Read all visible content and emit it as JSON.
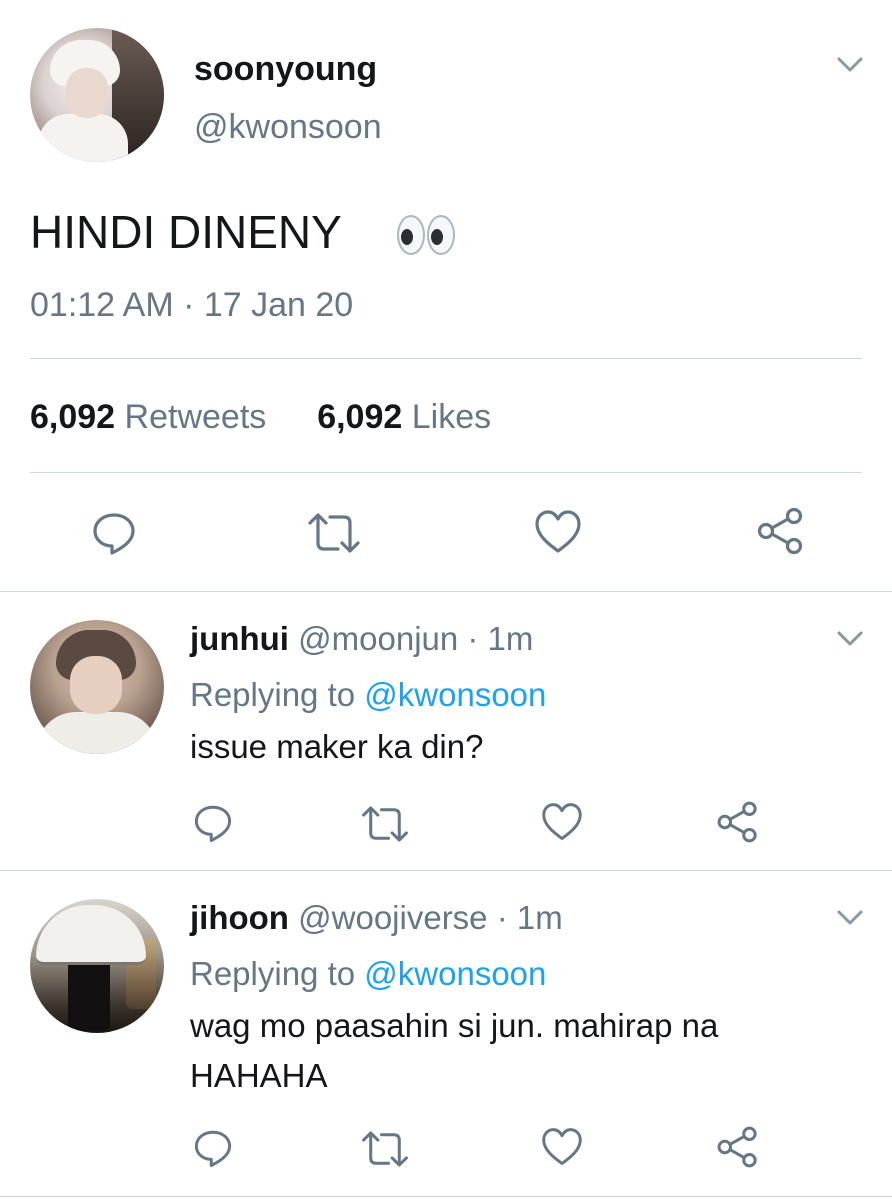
{
  "main_tweet": {
    "display_name": "soonyoung",
    "handle": "@kwonsoon",
    "text": "HINDI DINENY",
    "emoji": "eyes",
    "timestamp": "01:12 AM · 17 Jan 20",
    "retweets_count": "6,092",
    "retweets_label": "Retweets",
    "likes_count": "6,092",
    "likes_label": "Likes",
    "icons": [
      "chevron-down-icon",
      "reply-icon",
      "retweet-icon",
      "like-icon",
      "share-icon"
    ]
  },
  "replies": [
    {
      "display_name": "junhui",
      "handle_time": "@moonjun · 1m",
      "replying_prefix": "Replying to",
      "replying_to": "@kwonsoon",
      "text": "issue maker ka din?"
    },
    {
      "display_name": "jihoon",
      "handle_time": "@woojiverse · 1m",
      "replying_prefix": "Replying to",
      "replying_to": "@kwonsoon",
      "text": "wag mo paasahin si jun. mahirap na HAHAHA"
    }
  ],
  "colors": {
    "text": "#14171a",
    "secondary": "#657786",
    "link": "#1da1f2",
    "divider": "#ccd6dd"
  }
}
